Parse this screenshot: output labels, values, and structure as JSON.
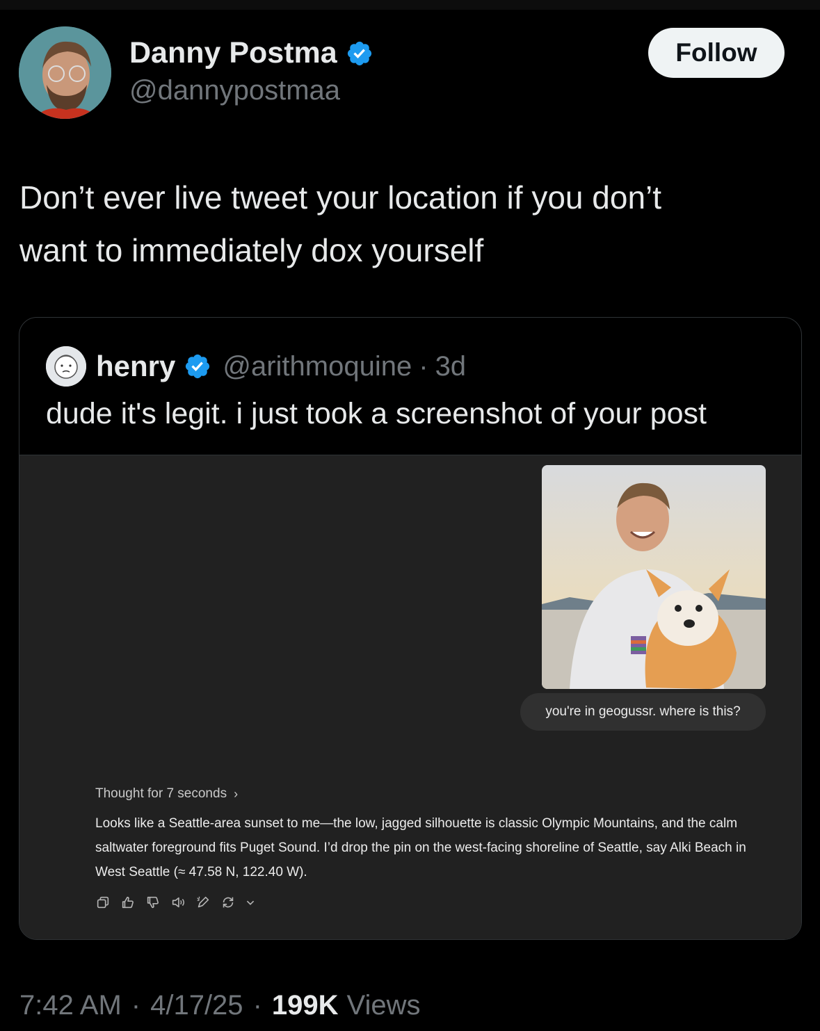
{
  "author": {
    "display_name": "Danny Postma",
    "handle": "@dannypostmaa",
    "verified_icon": "verified-badge-icon"
  },
  "follow_label": "Follow",
  "tweet_text": "Don’t ever live tweet your location if you don’t\nwant to immediately dox yourself",
  "quote": {
    "name": "henry",
    "handle": "@arithmoquine",
    "separator": "·",
    "time": "3d",
    "text": "dude it's legit. i just took a screenshot of your post",
    "embedded_chat": {
      "user_message": "you're in geogussr. where is this?",
      "thought_label": "Thought for 7 seconds",
      "thought_chevron": "›",
      "answer": "Looks like a Seattle-area sunset to me—the low, jagged silhouette is classic Olympic Mountains, and the calm saltwater foreground fits Puget Sound. I’d drop the pin on the west-facing shoreline of Seattle, say Alki Beach in West Seattle (≈ 47.58 N, 122.40 W).",
      "action_icons": [
        "copy-icon",
        "thumbs-up-icon",
        "thumbs-down-icon",
        "speaker-icon",
        "edit-icon",
        "regenerate-icon"
      ]
    }
  },
  "footer": {
    "time": "7:42 AM",
    "sep1": "·",
    "date": "4/17/25",
    "sep2": "·",
    "views_count": "199K",
    "views_label": "Views"
  },
  "colors": {
    "background": "#000000",
    "text": "#e7e9ea",
    "muted": "#71767b",
    "verified": "#1d9bf0",
    "follow_bg": "#eff3f4",
    "embed_bg": "#212121"
  }
}
